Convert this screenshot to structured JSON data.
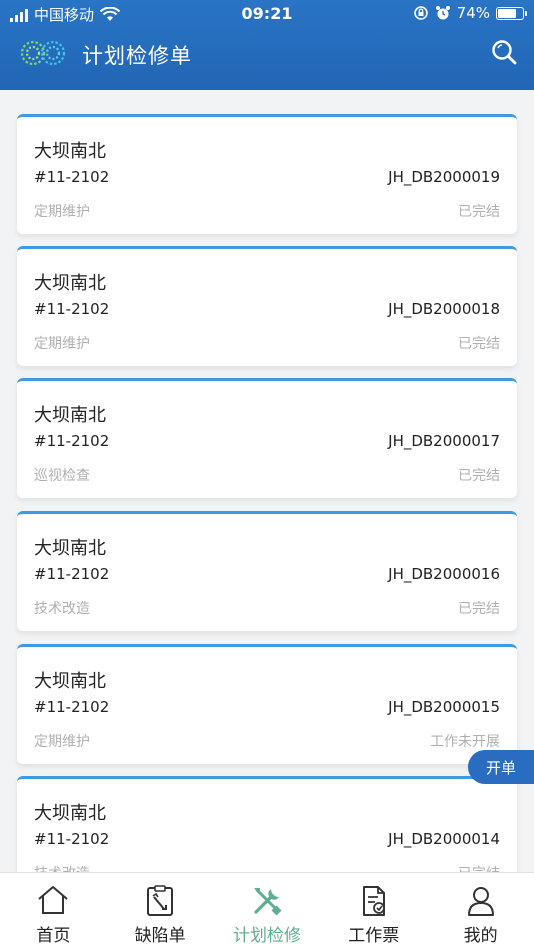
{
  "status_bar": {
    "carrier": "中国移动",
    "time": "09:21",
    "battery": "74%",
    "battery_level": 0.74
  },
  "header": {
    "title": "计划检修单",
    "logo_icon": "logo-icon",
    "search_icon": "search-icon"
  },
  "colors": {
    "header": "#2166b5",
    "card_border": "#3f9ae0",
    "active_tab": "#5fae8f",
    "float_button": "#2a6cc0"
  },
  "records": [
    {
      "title": "大坝南北",
      "code": "#11-2102",
      "number": "JH_DB2000019",
      "type": "定期维护",
      "status": "已完结"
    },
    {
      "title": "大坝南北",
      "code": "#11-2102",
      "number": "JH_DB2000018",
      "type": "定期维护",
      "status": "已完结"
    },
    {
      "title": "大坝南北",
      "code": "#11-2102",
      "number": "JH_DB2000017",
      "type": "巡视检查",
      "status": "已完结"
    },
    {
      "title": "大坝南北",
      "code": "#11-2102",
      "number": "JH_DB2000016",
      "type": "技术改造",
      "status": "已完结"
    },
    {
      "title": "大坝南北",
      "code": "#11-2102",
      "number": "JH_DB2000015",
      "type": "定期维护",
      "status": "工作未开展"
    },
    {
      "title": "大坝南北",
      "code": "#11-2102",
      "number": "JH_DB2000014",
      "type": "技术改造",
      "status": "已完结"
    }
  ],
  "float_button": {
    "label": "开单"
  },
  "tabs": [
    {
      "label": "首页",
      "icon": "home-icon"
    },
    {
      "label": "缺陷单",
      "icon": "defect-form-icon"
    },
    {
      "label": "计划检修",
      "icon": "tools-icon",
      "active": true
    },
    {
      "label": "工作票",
      "icon": "work-ticket-icon"
    },
    {
      "label": "我的",
      "icon": "user-icon"
    }
  ]
}
